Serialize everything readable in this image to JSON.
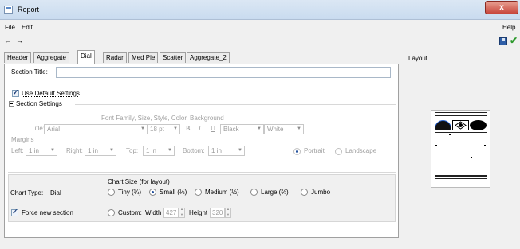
{
  "window": {
    "title": "Report",
    "close_glyph": "x"
  },
  "menu": {
    "file": "File",
    "edit": "Edit",
    "help": "Help"
  },
  "nav": {
    "back": "←",
    "forward": "→",
    "save_icon": "save-icon",
    "apply_icon": "checkmark-icon"
  },
  "tabs": [
    {
      "label": "Header",
      "active": false
    },
    {
      "label": "Aggregate",
      "active": false
    },
    {
      "label": "Dial",
      "active": true
    },
    {
      "label": "Radar",
      "active": false
    },
    {
      "label": "Med Pie",
      "active": false
    },
    {
      "label": "Scatter",
      "active": false
    },
    {
      "label": "Aggregate_2",
      "active": false
    }
  ],
  "section": {
    "title_label": "Section Title:",
    "title_value": "",
    "use_default_label": "Use Default Settings",
    "use_default_checked": true,
    "settings_label": "Section Settings",
    "font_header": "Font Family, Size, Style, Color, Background",
    "title_row_label": "Title:",
    "font_family": "Arial",
    "font_size": "18 pt",
    "bold": "B",
    "italic": "I",
    "underline": "U",
    "font_color": "Black",
    "background": "White",
    "margins_label": "Margins",
    "left_label": "Left:",
    "left_value": "1 in",
    "right_label": "Right:",
    "right_value": "1 in",
    "top_label": "Top:",
    "top_value": "1 in",
    "bottom_label": "Bottom:",
    "bottom_value": "1 in",
    "portrait": "Portrait",
    "landscape": "Landscape",
    "orientation_selected": "Portrait"
  },
  "chart": {
    "type_label": "Chart Type:",
    "type_value": "Dial",
    "size_label": "Chart Size (for layout)",
    "sizes": [
      {
        "label": "Tiny (¼)",
        "selected": false
      },
      {
        "label": "Small (⅓)",
        "selected": true
      },
      {
        "label": "Medium (½)",
        "selected": false
      },
      {
        "label": "Large (⅔)",
        "selected": false
      },
      {
        "label": "Jumbo",
        "selected": false
      }
    ],
    "force_new_label": "Force new section",
    "force_new_checked": true,
    "custom_label": "Custom:",
    "width_label": "Width",
    "width_value": "427",
    "height_label": "Height",
    "height_value": "320"
  },
  "layout": {
    "label": "Layout"
  }
}
